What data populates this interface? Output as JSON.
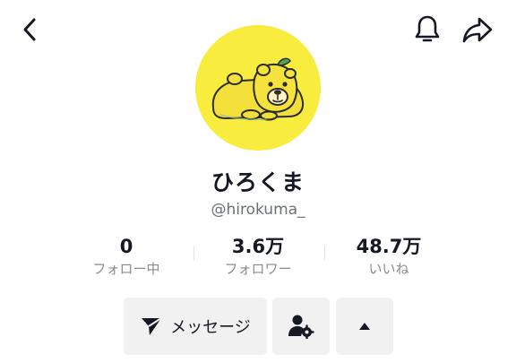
{
  "header": {
    "back_icon": "chevron-left-icon",
    "notification_icon": "bell-icon",
    "share_icon": "share-arrow-icon"
  },
  "profile": {
    "avatar_bg": "#f8ec3f",
    "name": "ひろくま",
    "handle": "@hirokuma_"
  },
  "stats": {
    "following": {
      "value": "0",
      "label": "フォロー中"
    },
    "followers": {
      "value": "3.6万",
      "label": "フォロワー"
    },
    "likes": {
      "value": "48.7万",
      "label": "いいね"
    }
  },
  "actions": {
    "message_label": "メッセージ",
    "message_icon": "send-arrow-icon",
    "friend_icon": "person-gear-icon",
    "more_icon": "caret-up-icon"
  },
  "colors": {
    "text": "#161823",
    "secondary": "#8a8b91",
    "button_bg": "#f1f1f2"
  }
}
